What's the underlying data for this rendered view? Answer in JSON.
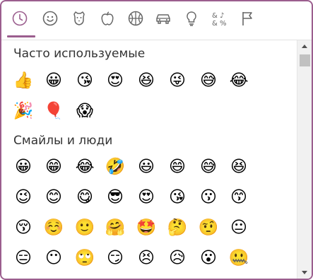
{
  "tabs": [
    {
      "name": "recent-icon",
      "active": true
    },
    {
      "name": "smiley-icon",
      "active": false
    },
    {
      "name": "animal-icon",
      "active": false
    },
    {
      "name": "food-icon",
      "active": false
    },
    {
      "name": "activity-icon",
      "active": false
    },
    {
      "name": "travel-icon",
      "active": false
    },
    {
      "name": "objects-icon",
      "active": false
    },
    {
      "name": "symbols-icon",
      "active": false
    },
    {
      "name": "flags-icon",
      "active": false
    }
  ],
  "accent_color": "#9b5e8e",
  "sections": [
    {
      "title": "Часто используемые",
      "emojis": [
        "👍",
        "😀",
        "😘",
        "😍",
        "😆",
        "😜",
        "😅",
        "😂",
        "🎉",
        "🎈",
        "😱"
      ]
    },
    {
      "title": "Смайлы и люди",
      "emojis": [
        "😀",
        "😁",
        "😂",
        "🤣",
        "😃",
        "😄",
        "😅",
        "😆",
        "😉",
        "😊",
        "😋",
        "😎",
        "😍",
        "😘",
        "😗",
        "😙",
        "😚",
        "☺️",
        "🙂",
        "🤗",
        "🤩",
        "🤔",
        "🤨",
        "😐",
        "😑",
        "😶",
        "🙄",
        "😏",
        "😣",
        "😥",
        "😮",
        "🤐"
      ]
    }
  ]
}
